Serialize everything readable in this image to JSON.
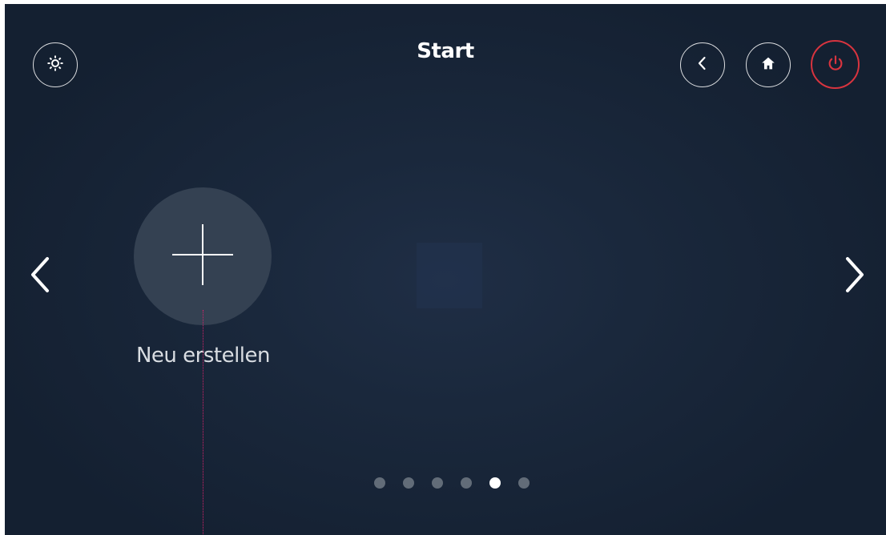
{
  "header": {
    "title": "Start",
    "settings_icon": "gear-icon",
    "back_icon": "chevron-left-icon",
    "home_icon": "home-icon",
    "power_icon": "power-icon"
  },
  "main": {
    "add_tile": {
      "icon": "plus-icon",
      "label": "Neu erstellen"
    },
    "prev_icon": "chevron-left-icon",
    "next_icon": "chevron-right-icon"
  },
  "pagination": {
    "total_pages": 6,
    "active_page": 5
  },
  "colors": {
    "background": "#1a283c",
    "power_accent": "#d8343f",
    "tile": "#344152",
    "dot_inactive": "#626c78",
    "dot_active": "#ffffff"
  }
}
